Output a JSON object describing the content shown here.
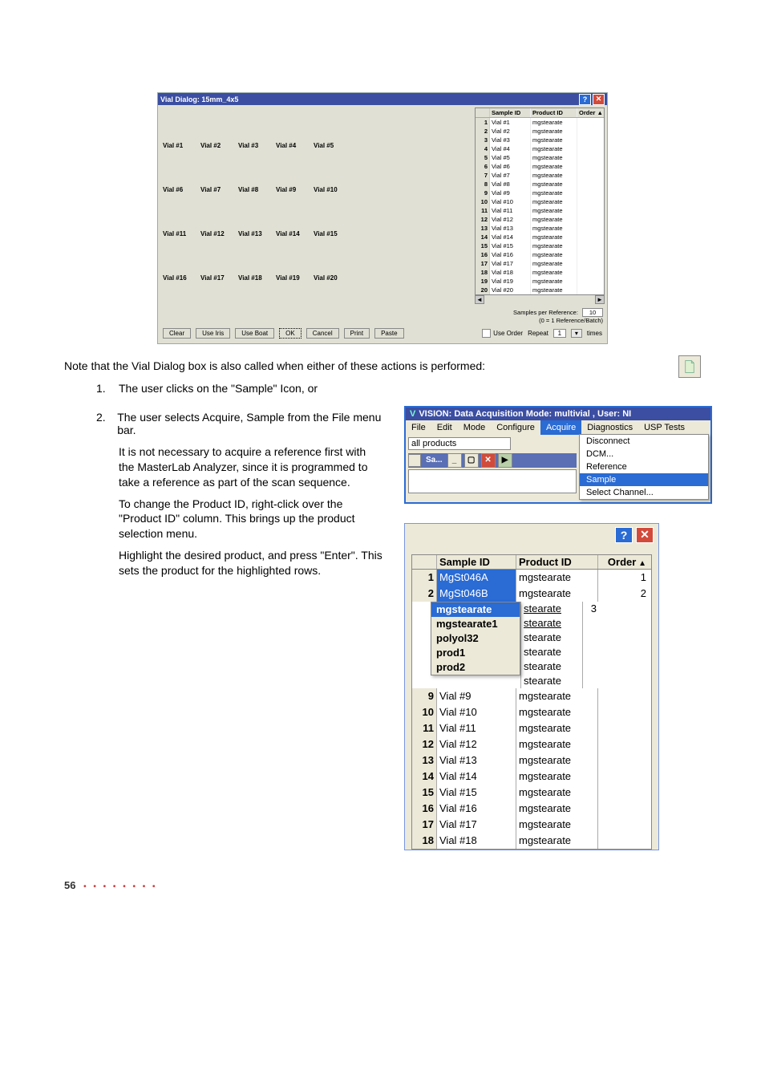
{
  "vial_dialog": {
    "title": "Vial Dialog: 15mm_4x5",
    "grid": [
      [
        "Vial #1",
        "Vial #2",
        "Vial #3",
        "Vial #4",
        "Vial #5"
      ],
      [
        "Vial #6",
        "Vial #7",
        "Vial #8",
        "Vial #9",
        "Vial #10"
      ],
      [
        "Vial #11",
        "Vial #12",
        "Vial #13",
        "Vial #14",
        "Vial #15"
      ],
      [
        "Vial #16",
        "Vial #17",
        "Vial #18",
        "Vial #19",
        "Vial #20"
      ]
    ],
    "table": {
      "headers": {
        "sample": "Sample ID",
        "product": "Product ID",
        "order": "Order"
      },
      "rows": [
        {
          "n": "1",
          "s": "Vial #1",
          "p": "mgstearate"
        },
        {
          "n": "2",
          "s": "Vial #2",
          "p": "mgstearate"
        },
        {
          "n": "3",
          "s": "Vial #3",
          "p": "mgstearate"
        },
        {
          "n": "4",
          "s": "Vial #4",
          "p": "mgstearate"
        },
        {
          "n": "5",
          "s": "Vial #5",
          "p": "mgstearate"
        },
        {
          "n": "6",
          "s": "Vial #6",
          "p": "mgstearate"
        },
        {
          "n": "7",
          "s": "Vial #7",
          "p": "mgstearate"
        },
        {
          "n": "8",
          "s": "Vial #8",
          "p": "mgstearate"
        },
        {
          "n": "9",
          "s": "Vial #9",
          "p": "mgstearate"
        },
        {
          "n": "10",
          "s": "Vial #10",
          "p": "mgstearate"
        },
        {
          "n": "11",
          "s": "Vial #11",
          "p": "mgstearate"
        },
        {
          "n": "12",
          "s": "Vial #12",
          "p": "mgstearate"
        },
        {
          "n": "13",
          "s": "Vial #13",
          "p": "mgstearate"
        },
        {
          "n": "14",
          "s": "Vial #14",
          "p": "mgstearate"
        },
        {
          "n": "15",
          "s": "Vial #15",
          "p": "mgstearate"
        },
        {
          "n": "16",
          "s": "Vial #16",
          "p": "mgstearate"
        },
        {
          "n": "17",
          "s": "Vial #17",
          "p": "mgstearate"
        },
        {
          "n": "18",
          "s": "Vial #18",
          "p": "mgstearate"
        },
        {
          "n": "19",
          "s": "Vial #19",
          "p": "mgstearate"
        },
        {
          "n": "20",
          "s": "Vial #20",
          "p": "mgstearate"
        }
      ]
    },
    "spr": {
      "label": "Samples per Reference:",
      "sub": "(0 = 1 Reference/Batch)",
      "value": "10"
    },
    "footer": {
      "clear": "Clear",
      "use_iris": "Use Iris",
      "use_boat": "Use Boat",
      "ok": "OK",
      "cancel": "Cancel",
      "print": "Print",
      "paste": "Paste",
      "use_order": "Use Order",
      "repeat": "Repeat",
      "repeat_val": "1",
      "times": "times"
    }
  },
  "body": {
    "note": "Note that the Vial Dialog box is also called when either of these actions is performed:",
    "item1": "The user clicks on the \"Sample\" Icon, or",
    "item2": "The user selects Acquire, Sample from the File menu bar.",
    "p1": "It is not necessary to acquire a reference first with the MasterLab Analyzer, since it is programmed to take a reference as part of the scan sequence.",
    "p2": "To change the Product ID, right-click over the \"Product ID\" column. This brings up the product selection menu.",
    "p3": "Highlight the desired product, and press \"Enter\". This sets the product for the highlighted rows."
  },
  "vision": {
    "title": "VISION: Data Acquisition Mode: multivial , User: NI",
    "menus": [
      "File",
      "Edit",
      "Mode",
      "Configure",
      "Acquire",
      "Diagnostics",
      "USP Tests"
    ],
    "active_menu": "Acquire",
    "field": "all products",
    "sa": "Sa...",
    "sa_btn_close": "✕",
    "drop": [
      "Disconnect",
      "DCM...",
      "Reference",
      "Sample",
      "Select Channel..."
    ],
    "drop_hi": "Sample"
  },
  "prod": {
    "headers": {
      "sample": "Sample ID",
      "product": "Product ID",
      "order": "Order"
    },
    "row1": {
      "n": "1",
      "s": "MgSt046A",
      "p": "mgstearate",
      "o": "1"
    },
    "row2": {
      "n": "2",
      "s": "MgSt046B",
      "p": "mgstearate",
      "o": "2"
    },
    "popup": [
      "mgstearate",
      "mgstearate1",
      "polyol32",
      "prod1",
      "prod2"
    ],
    "popup_sel": "mgstearate",
    "right": [
      "stearate",
      "stearate",
      "stearate",
      "stearate",
      "stearate",
      "stearate"
    ],
    "right_ord3": "3",
    "rows": [
      {
        "n": "9",
        "s": "Vial #9",
        "p": "mgstearate"
      },
      {
        "n": "10",
        "s": "Vial #10",
        "p": "mgstearate"
      },
      {
        "n": "11",
        "s": "Vial #11",
        "p": "mgstearate"
      },
      {
        "n": "12",
        "s": "Vial #12",
        "p": "mgstearate"
      },
      {
        "n": "13",
        "s": "Vial #13",
        "p": "mgstearate"
      },
      {
        "n": "14",
        "s": "Vial #14",
        "p": "mgstearate"
      },
      {
        "n": "15",
        "s": "Vial #15",
        "p": "mgstearate"
      },
      {
        "n": "16",
        "s": "Vial #16",
        "p": "mgstearate"
      },
      {
        "n": "17",
        "s": "Vial #17",
        "p": "mgstearate"
      },
      {
        "n": "18",
        "s": "Vial #18",
        "p": "mgstearate"
      }
    ]
  },
  "footer": {
    "page": "56"
  }
}
